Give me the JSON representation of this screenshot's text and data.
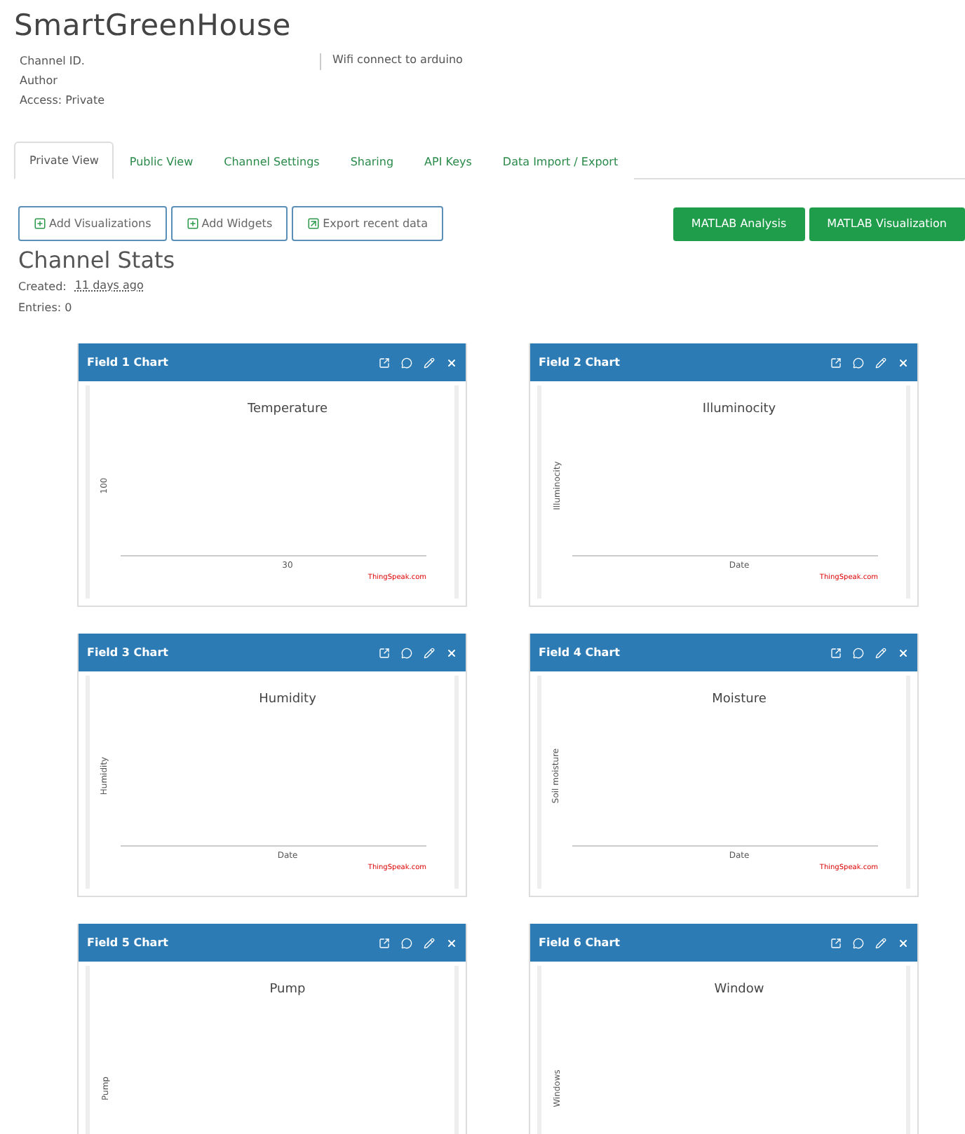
{
  "title": "SmartGreenHouse",
  "meta": [
    "Channel ID.",
    "Author",
    "Access: Private"
  ],
  "description": "Wifi connect to arduino",
  "tabs": [
    {
      "label": "Private View",
      "selected": true
    },
    {
      "label": "Public View",
      "selected": false
    },
    {
      "label": "Channel Settings",
      "selected": false
    },
    {
      "label": "Sharing",
      "selected": false
    },
    {
      "label": "API Keys",
      "selected": false
    },
    {
      "label": "Data Import / Export",
      "selected": false
    }
  ],
  "actions": [
    {
      "label": "Add Visualizations",
      "kind": "plus"
    },
    {
      "label": "Add Widgets",
      "kind": "plus"
    },
    {
      "label": "Export recent data",
      "kind": "export"
    }
  ],
  "matlab_buttons": [
    "MATLAB Analysis",
    "MATLAB Visualization"
  ],
  "stats": {
    "heading": "Channel Stats",
    "created_label": "Created:",
    "created_value": "11 days ago",
    "entries": "Entries: 0"
  },
  "charts": [
    {
      "header": "Field 1 Chart",
      "title": "Temperature",
      "ylabel": "100",
      "xlabel": "30",
      "credit": "ThingSpeak.com"
    },
    {
      "header": "Field 2 Chart",
      "title": "Illuminocity",
      "ylabel": "Illuminocity",
      "xlabel": "Date",
      "credit": "ThingSpeak.com"
    },
    {
      "header": "Field 3 Chart",
      "title": "Humidity",
      "ylabel": "Humidity",
      "xlabel": "Date",
      "credit": "ThingSpeak.com"
    },
    {
      "header": "Field 4 Chart",
      "title": "Moisture",
      "ylabel": "Soil moisture",
      "xlabel": "Date",
      "credit": "ThingSpeak.com"
    },
    {
      "header": "Field 5 Chart",
      "title": "Pump",
      "ylabel": "Pump"
    },
    {
      "header": "Field 6 Chart",
      "title": "Window",
      "ylabel": "Windows"
    }
  ]
}
